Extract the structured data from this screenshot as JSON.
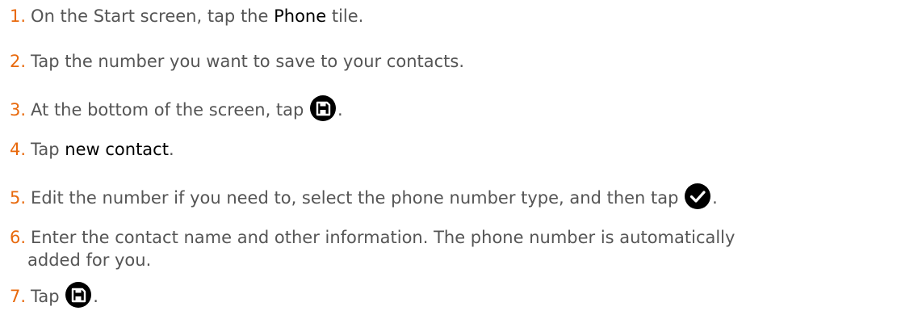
{
  "steps": [
    {
      "number": "1.",
      "before": "On the Start screen, tap the ",
      "highlight": "Phone",
      "after": " tile."
    },
    {
      "number": "2.",
      "text": "Tap the number you want to save to your contacts."
    },
    {
      "number": "3.",
      "before": "At the bottom of the screen, tap ",
      "icon": "save-icon",
      "after": "."
    },
    {
      "number": "4.",
      "before": "Tap ",
      "highlight": "new contact",
      "after": "."
    },
    {
      "number": "5.",
      "before": "Edit the number if you need to, select the phone number type, and then tap ",
      "icon": "check-icon",
      "after": "."
    },
    {
      "number": "6.",
      "line1": "Enter the contact name and other information. The phone number is automatically",
      "line2": "added for you."
    },
    {
      "number": "7.",
      "before": "Tap ",
      "icon": "save-icon",
      "after": "."
    }
  ],
  "colors": {
    "step_number": "#e8690c",
    "body_text": "#555555",
    "highlight_text": "#000000",
    "icon_fill": "#000000"
  }
}
